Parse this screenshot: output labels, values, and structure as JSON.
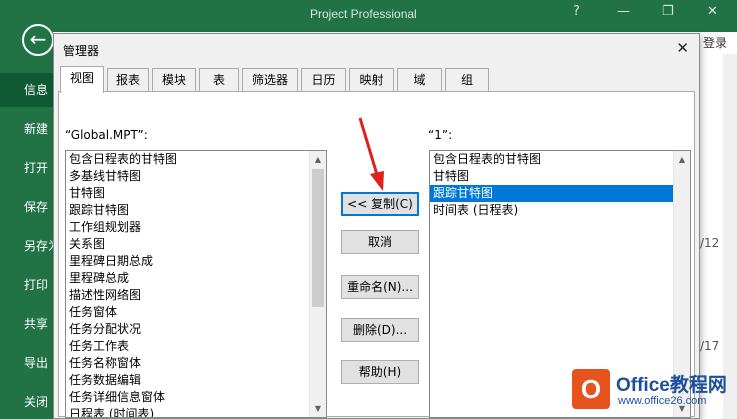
{
  "app": {
    "title": "Project Professional",
    "help": "?",
    "login": "登录",
    "back_glyph": "←",
    "side_dates": [
      "/12",
      "/17"
    ]
  },
  "backstage": {
    "items": [
      {
        "label": "信息",
        "active": true
      },
      {
        "label": "新建"
      },
      {
        "label": "打开"
      },
      {
        "label": "保存"
      },
      {
        "label": "另存为"
      },
      {
        "label": "打印"
      },
      {
        "label": "共享"
      },
      {
        "label": "导出"
      },
      {
        "label": "关闭"
      }
    ]
  },
  "dialog": {
    "title": "管理器",
    "close": "✕",
    "tabs": [
      {
        "label": "视图",
        "selected": true
      },
      {
        "label": "报表"
      },
      {
        "label": "模块"
      },
      {
        "label": "表"
      },
      {
        "label": "筛选器"
      },
      {
        "label": "日历"
      },
      {
        "label": "映射"
      },
      {
        "label": "域"
      },
      {
        "label": "组"
      }
    ],
    "left_caption": "“Global.MPT”:",
    "right_caption": "“1”:",
    "left_items": [
      "包含日程表的甘特图",
      "多基线甘特图",
      "甘特图",
      "跟踪甘特图",
      "工作组规划器",
      "关系图",
      "里程碑日期总成",
      "里程碑总成",
      "描述性网络图",
      "任务窗体",
      "任务分配状况",
      "任务工作表",
      "任务名称窗体",
      "任务数据编辑",
      "任务详细信息窗体",
      "日程表 (时间表)"
    ],
    "right_items": [
      {
        "label": "包含日程表的甘特图"
      },
      {
        "label": "甘特图"
      },
      {
        "label": "跟踪甘特图",
        "selected": true
      },
      {
        "label": "时间表 (日程表)"
      }
    ],
    "buttons": {
      "copy": "<< 复制(C)",
      "cancel": "取消",
      "rename": "重命名(N)...",
      "delete": "删除(D)...",
      "help": "帮助(H)"
    }
  },
  "logo": {
    "badge": "O",
    "text": "Office教程网",
    "url": "www.office26.com"
  },
  "colors": {
    "brand_green": "#217346",
    "selection_blue": "#0078d7",
    "annotation_red": "#e0201c",
    "logo_orange": "#e8521d"
  }
}
